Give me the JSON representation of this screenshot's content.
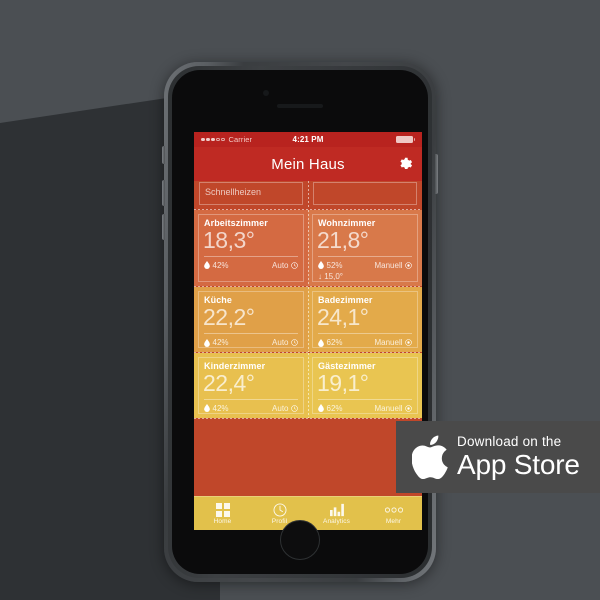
{
  "phone": {
    "status_bar": {
      "signal_filled": 3,
      "signal_empty": 2,
      "carrier": "Carrier",
      "time": "4:21 PM",
      "battery_icon": "battery-full-icon"
    },
    "nav_bar": {
      "title": "Mein Haus",
      "settings_icon": "gear-icon"
    },
    "top_partial_row": {
      "left_label": "Schnellheizen",
      "right_label": ""
    },
    "rooms": [
      {
        "name": "Arbeitszimmer",
        "temperature": "18,3°",
        "humidity": "42%",
        "mode": "Auto",
        "mode_icon": "clock-icon",
        "humidity_icon": "droplet-icon",
        "setpoint": "",
        "color": "#d46a42"
      },
      {
        "name": "Wohnzimmer",
        "temperature": "21,8°",
        "humidity": "52%",
        "mode": "Manuell",
        "mode_icon": "target-icon",
        "humidity_icon": "droplet-icon",
        "setpoint": "↓ 15,0°",
        "color": "#d8794a"
      },
      {
        "name": "Küche",
        "temperature": "22,2°",
        "humidity": "42%",
        "mode": "Auto",
        "mode_icon": "clock-icon",
        "humidity_icon": "droplet-icon",
        "setpoint": "",
        "color": "#e0a048"
      },
      {
        "name": "Badezimmer",
        "temperature": "24,1°",
        "humidity": "62%",
        "mode": "Manuell",
        "mode_icon": "target-icon",
        "humidity_icon": "droplet-icon",
        "setpoint": "",
        "color": "#e3aa4a"
      },
      {
        "name": "Kinderzimmer",
        "temperature": "22,4°",
        "humidity": "42%",
        "mode": "Auto",
        "mode_icon": "clock-icon",
        "humidity_icon": "droplet-icon",
        "setpoint": "",
        "color": "#e8c04f"
      },
      {
        "name": "Gästezimmer",
        "temperature": "19,1°",
        "humidity": "62%",
        "mode": "Manuell",
        "mode_icon": "target-icon",
        "humidity_icon": "droplet-icon",
        "setpoint": "",
        "color": "#e9c551"
      }
    ],
    "tab_bar": [
      {
        "label": "Home",
        "icon": "grid-icon"
      },
      {
        "label": "Profil",
        "icon": "clock-icon"
      },
      {
        "label": "Analytics",
        "icon": "bar-chart-icon"
      },
      {
        "label": "Mehr",
        "icon": "more-dots-icon"
      }
    ]
  },
  "badge": {
    "apple_icon": "apple-logo-icon",
    "small_text": "Download on the",
    "large_text": "App Store"
  },
  "colors": {
    "background": "#4b4f53",
    "shadow": "#2e3134",
    "status_bar": "#b8231f",
    "nav_bar": "#bf2a23",
    "grid_gutter": "#c0472a",
    "tab_bar": "#e2c14b",
    "badge_bg": "#4a4a4a"
  }
}
